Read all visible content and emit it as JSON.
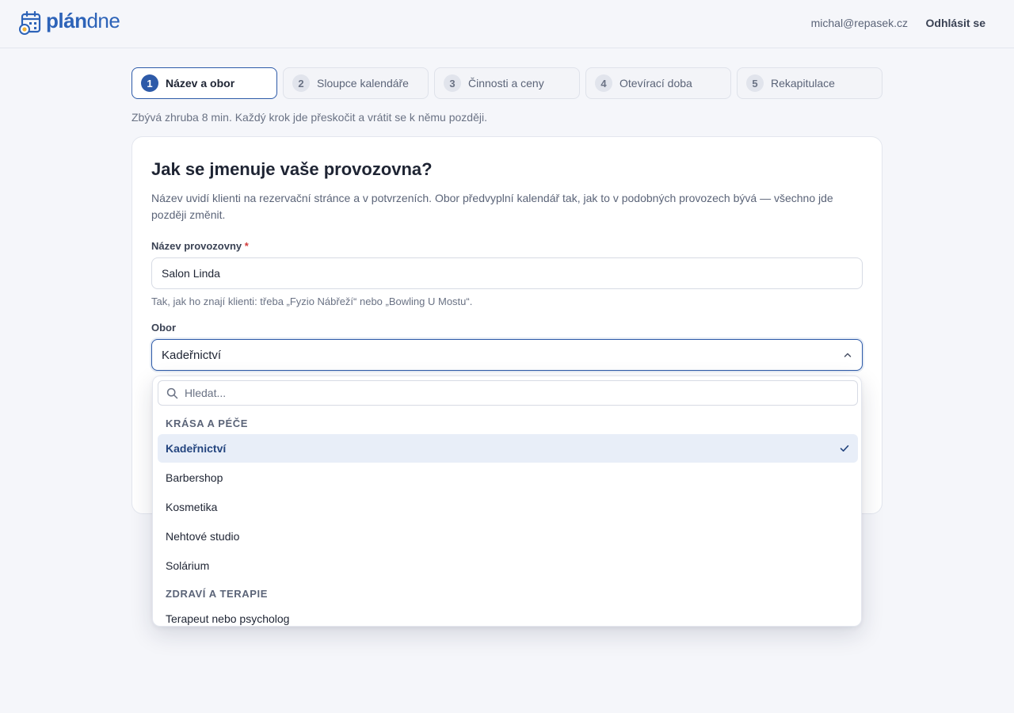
{
  "header": {
    "logo_bold": "plán",
    "logo_light": "dne",
    "user_email": "michal@repasek.cz",
    "logout_label": "Odhlásit se"
  },
  "stepper": [
    {
      "num": "1",
      "label": "Název a obor",
      "active": true
    },
    {
      "num": "2",
      "label": "Sloupce kalendáře",
      "active": false
    },
    {
      "num": "3",
      "label": "Činnosti a ceny",
      "active": false
    },
    {
      "num": "4",
      "label": "Otevírací doba",
      "active": false
    },
    {
      "num": "5",
      "label": "Rekapitulace",
      "active": false
    }
  ],
  "time_hint": "Zbývá zhruba 8 min. Každý krok jde přeskočit a vrátit se k němu později.",
  "card": {
    "title": "Jak se jmenuje vaše provozovna?",
    "description": "Název uvidí klienti na rezervační stránce a v potvrzeních. Obor předvyplní kalendář tak, jak to v podobných provozech bývá — všechno jde později změnit.",
    "name_label": "Název provozovny",
    "required_mark": "*",
    "name_value": "Salon Linda",
    "name_help": "Tak, jak ho znají klienti: třeba „Fyzio Nábřeží“ nebo „Bowling U Mostu“.",
    "field_label": "Obor",
    "field_value": "Kadeřnictví"
  },
  "dropdown": {
    "search_placeholder": "Hledat...",
    "groups": [
      {
        "heading": "KRÁSA A PÉČE",
        "options": [
          "Kadeřnictví",
          "Barbershop",
          "Kosmetika",
          "Nehtové studio",
          "Solárium"
        ]
      },
      {
        "heading": "ZDRAVÍ A TERAPIE",
        "options": [
          "Terapeut nebo psycholog"
        ]
      }
    ],
    "selected": "Kadeřnictví"
  },
  "colors": {
    "accent": "#2d5aa8",
    "brand": "#2d63b8",
    "selected_bg": "#e8eef8",
    "page_bg": "#f5f6fa"
  }
}
